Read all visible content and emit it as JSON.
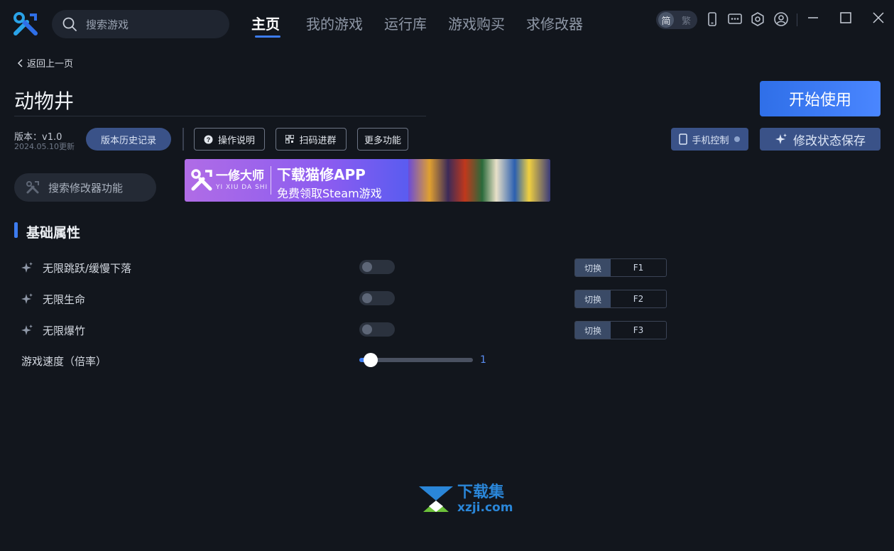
{
  "topbar": {
    "search_placeholder": "搜索游戏",
    "nav": [
      {
        "label": "主页",
        "active": true
      },
      {
        "label": "我的游戏",
        "active": false
      },
      {
        "label": "运行库",
        "active": false
      },
      {
        "label": "游戏购买",
        "active": false
      },
      {
        "label": "求修改器",
        "active": false
      }
    ],
    "lang": {
      "selected": "简",
      "other": "繁"
    },
    "icons": [
      "phone-icon",
      "chat-icon",
      "settings-icon",
      "user-icon",
      "minimize-icon",
      "maximize-icon",
      "close-icon"
    ]
  },
  "page": {
    "back_label": "返回上一页",
    "title": "动物井",
    "start_label": "开始使用",
    "version": "版本：v1.0",
    "version_date": "2024.05.10更新",
    "history_label": "版本历史记录",
    "manual_label": "操作说明",
    "qr_label": "扫码进群",
    "more_label": "更多功能",
    "phone_control_label": "手机控制",
    "save_state_label": "修改状态保存",
    "feature_search_placeholder": "搜索修改器功能"
  },
  "banner": {
    "brand": "一修大师",
    "pinyin": "YI XIU DA SHI",
    "headline": "下载猫修APP",
    "subline": "免费领取Steam游戏"
  },
  "section": {
    "title": "基础属性",
    "toggle_label": "切换",
    "features": [
      {
        "label": "无限跳跃/缓慢下落",
        "enabled": false,
        "hotkey": "F1"
      },
      {
        "label": "无限生命",
        "enabled": false,
        "hotkey": "F2"
      },
      {
        "label": "无限爆竹",
        "enabled": false,
        "hotkey": "F3"
      }
    ],
    "speed": {
      "label": "游戏速度（倍率）",
      "value": "1",
      "level": 0.1
    }
  },
  "watermark": {
    "line1": "下载集",
    "line2": "xzji.com"
  },
  "colors": {
    "accent": "#3d7cf0",
    "background": "#12161d"
  }
}
